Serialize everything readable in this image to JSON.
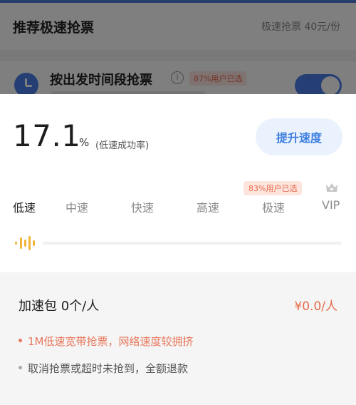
{
  "background": {
    "header_title": "推荐极速抢票",
    "header_right": "极速抢票 40元/份",
    "row_title": "按出发时间段抢票",
    "row_info_icon": "i",
    "row_tag": "87%用户已选",
    "toggle_on": true
  },
  "success_rate": {
    "value": "17.1",
    "unit": "%",
    "label": "(低速成功率)"
  },
  "boost_button": "提升速度",
  "speed_tiers": {
    "items": [
      "低速",
      "中速",
      "快速",
      "高速",
      "极速",
      "VIP"
    ],
    "selected": "低速",
    "badge": "83%用户已选"
  },
  "slider": {
    "level": 0
  },
  "package": {
    "title": "加速包 0个/人",
    "price": "¥0.0/人",
    "notes": [
      "1M低速宽带抢票，网络速度较拥挤",
      "取消抢票或超时未抢到，全额退款"
    ]
  },
  "colors": {
    "accent": "#3e7fe0",
    "price": "#e66a4a",
    "badge_bg": "#fde5de"
  }
}
